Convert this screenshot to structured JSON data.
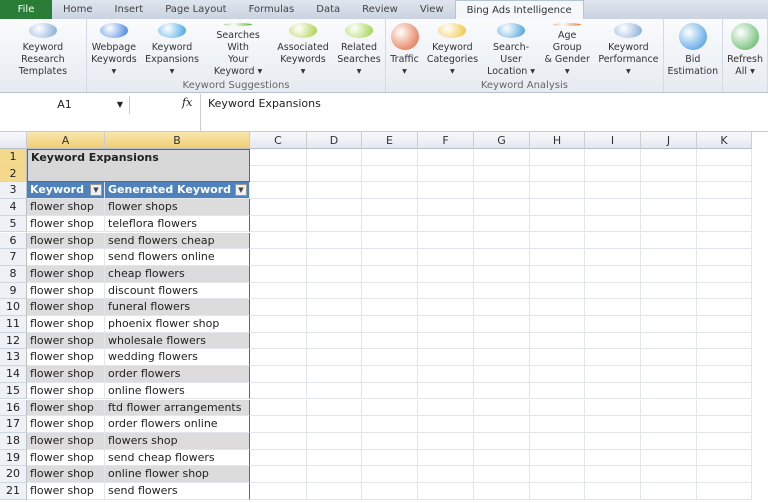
{
  "tabs": [
    "File",
    "Home",
    "Insert",
    "Page Layout",
    "Formulas",
    "Data",
    "Review",
    "View",
    "Bing Ads Intelligence"
  ],
  "active_tab": "Bing Ads Intelligence",
  "ribbon": {
    "groups": [
      {
        "label": "",
        "buttons": [
          {
            "l1": "Keyword Research",
            "l2": "Templates",
            "icon": "templates-icon",
            "color": "#7aa6d8"
          }
        ]
      },
      {
        "label": "Keyword Suggestions",
        "buttons": [
          {
            "l1": "Webpage",
            "l2": "Keywords ▾",
            "icon": "network-icon",
            "color": "#3a7be0"
          },
          {
            "l1": "Keyword",
            "l2": "Expansions ▾",
            "icon": "expansion-icon",
            "color": "#37a0e0"
          },
          {
            "l1": "Searches With",
            "l2": "Your Keyword ▾",
            "icon": "target-icon",
            "color": "#5cb531"
          },
          {
            "l1": "Associated",
            "l2": "Keywords ▾",
            "icon": "dollar-tree-icon",
            "color": "#a8cc3c"
          },
          {
            "l1": "Related",
            "l2": "Searches ▾",
            "icon": "related-icon",
            "color": "#9ccf3d"
          }
        ]
      },
      {
        "label": "Keyword Analysis",
        "buttons": [
          {
            "l1": "Traffic",
            "l2": "▾",
            "icon": "bar-chart-icon",
            "color": "#e05a2b"
          },
          {
            "l1": "Keyword",
            "l2": "Categories ▾",
            "icon": "categories-icon",
            "color": "#f0c030"
          },
          {
            "l1": "Search-User",
            "l2": "Location ▾",
            "icon": "globe-icon",
            "color": "#3d9bd9"
          },
          {
            "l1": "Age Group",
            "l2": "& Gender ▾",
            "icon": "people-icon",
            "color": "#e0803a"
          },
          {
            "l1": "Keyword",
            "l2": "Performance ▾",
            "icon": "performance-icon",
            "color": "#7fa8d8"
          }
        ]
      },
      {
        "label": "",
        "buttons": [
          {
            "l1": "Bid",
            "l2": "Estimation",
            "icon": "bid-icon",
            "color": "#2f8fe0"
          }
        ]
      },
      {
        "label": "",
        "buttons": [
          {
            "l1": "Refresh",
            "l2": "All ▾",
            "icon": "refresh-icon",
            "color": "#4caf50"
          }
        ]
      }
    ]
  },
  "formula_bar": {
    "name_box": "A1",
    "fx": "fx",
    "value": "Keyword Expansions"
  },
  "columns": [
    "A",
    "B",
    "C",
    "D",
    "E",
    "F",
    "G",
    "H",
    "I",
    "J",
    "K"
  ],
  "sheet": {
    "title": "Keyword Expansions",
    "headers": [
      "Keyword",
      "Generated Keyword"
    ],
    "rows": [
      [
        "flower shop",
        "flower shops"
      ],
      [
        "flower shop",
        "teleflora flowers"
      ],
      [
        "flower shop",
        "send flowers cheap"
      ],
      [
        "flower shop",
        "send flowers online"
      ],
      [
        "flower shop",
        "cheap flowers"
      ],
      [
        "flower shop",
        "discount flowers"
      ],
      [
        "flower shop",
        "funeral flowers"
      ],
      [
        "flower shop",
        "phoenix flower shop"
      ],
      [
        "flower shop",
        "wholesale flowers"
      ],
      [
        "flower shop",
        "wedding flowers"
      ],
      [
        "flower shop",
        "order flowers"
      ],
      [
        "flower shop",
        "online flowers"
      ],
      [
        "flower shop",
        "ftd flower arrangements"
      ],
      [
        "flower shop",
        "order flowers online"
      ],
      [
        "flower shop",
        "flowers shop"
      ],
      [
        "flower shop",
        "send cheap flowers"
      ],
      [
        "flower shop",
        "online flower shop"
      ],
      [
        "flower shop",
        "send flowers"
      ]
    ]
  }
}
